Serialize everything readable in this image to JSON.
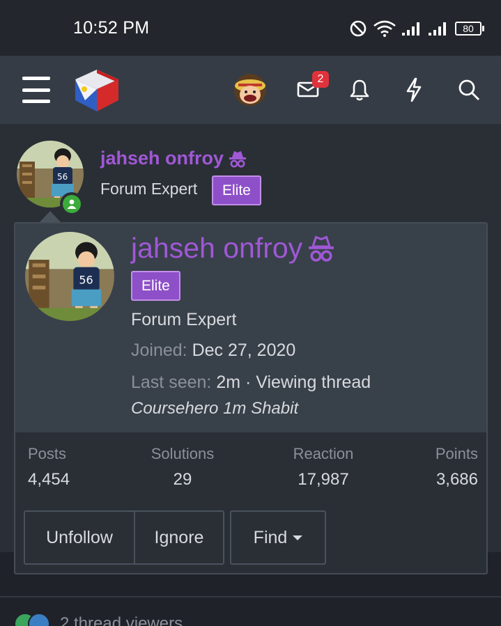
{
  "status_bar": {
    "time": "10:52 PM",
    "battery": "80",
    "icons": [
      "dnd-icon",
      "wifi-icon",
      "signal-icon",
      "signal-icon",
      "battery-icon"
    ]
  },
  "nav": {
    "icons": [
      "menu-icon",
      "site-logo",
      "user-avatar",
      "mail-icon",
      "bell-icon",
      "bolt-icon",
      "search-icon"
    ],
    "mail_badge": "2"
  },
  "user_header": {
    "name": "jahseh onfroy",
    "title": "Forum Expert",
    "banner": "Elite",
    "online": true
  },
  "card": {
    "name": "jahseh onfroy",
    "banner": "Elite",
    "title": "Forum Expert",
    "joined_label": "Joined:",
    "joined_value": "Dec 27, 2020",
    "last_seen_label": "Last seen:",
    "last_seen_value": "2m · Viewing thread",
    "activity": "Coursehero 1m Shabit",
    "stats": [
      {
        "label": "Posts",
        "value": "4,454"
      },
      {
        "label": "Solutions",
        "value": "29"
      },
      {
        "label": "Reaction",
        "value": "17,987"
      },
      {
        "label": "Points",
        "value": "3,686"
      }
    ],
    "buttons": {
      "unfollow": "Unfollow",
      "ignore": "Ignore",
      "find": "Find"
    }
  },
  "viewers": {
    "text": "2 thread viewers"
  },
  "colors": {
    "accent_purple": "#a058d6",
    "elite_bg": "#8e50c8",
    "online_green": "#3cab3c",
    "badge_red": "#e0323b"
  }
}
